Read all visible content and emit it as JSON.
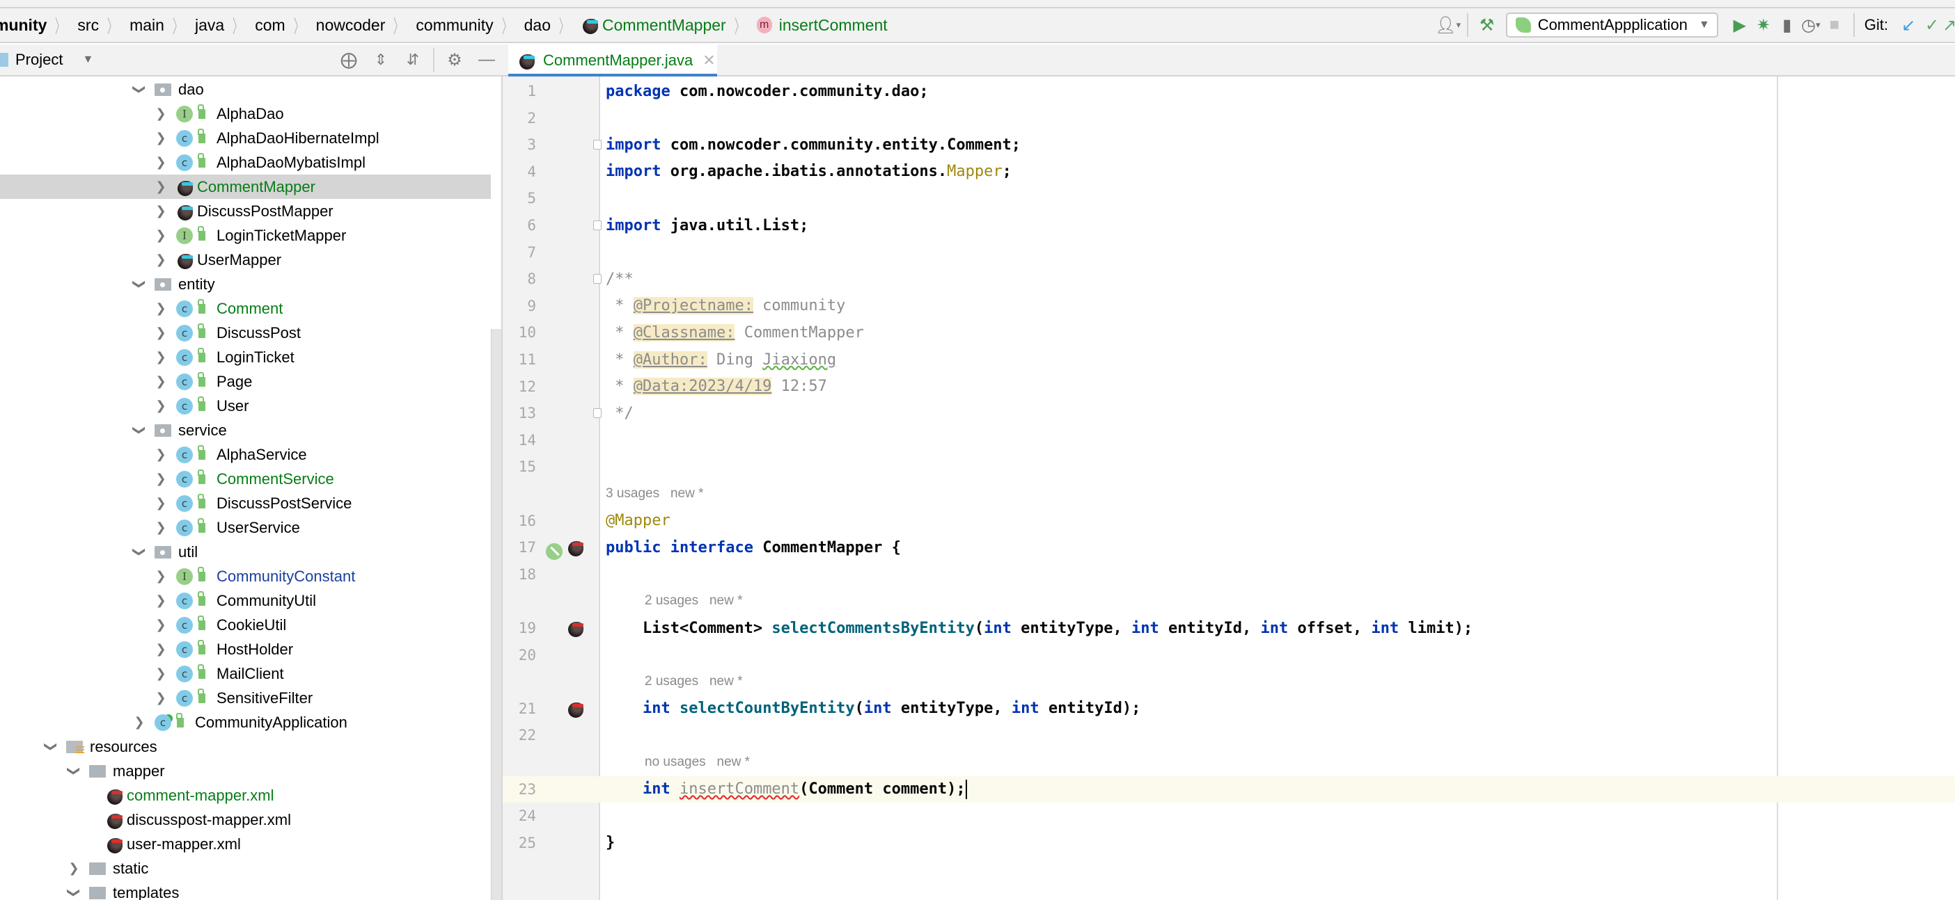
{
  "breadcrumb": {
    "items": [
      {
        "label": "munity",
        "style": "first"
      },
      {
        "label": "src"
      },
      {
        "label": "main"
      },
      {
        "label": "java"
      },
      {
        "label": "com"
      },
      {
        "label": "nowcoder"
      },
      {
        "label": "community"
      },
      {
        "label": "dao"
      },
      {
        "label": "CommentMapper",
        "icon": "mybatis-mapper-icon",
        "style": "green"
      },
      {
        "label": "insertComment",
        "icon": "method-icon",
        "style": "green"
      }
    ],
    "method_badge": "m"
  },
  "toolbar": {
    "run_config": "CommentAppplication",
    "git_label": "Git:"
  },
  "project_panel": {
    "title": "Project"
  },
  "tabs": [
    {
      "label": "CommentMapper.java",
      "active": true
    }
  ],
  "tree": [
    {
      "label": "dao",
      "type": "package",
      "level": 0,
      "expanded": true
    },
    {
      "label": "AlphaDao",
      "type": "interface",
      "level": 1,
      "color": "default"
    },
    {
      "label": "AlphaDaoHibernateImpl",
      "type": "class",
      "level": 1,
      "color": "default"
    },
    {
      "label": "AlphaDaoMybatisImpl",
      "type": "class",
      "level": 1,
      "color": "default"
    },
    {
      "label": "CommentMapper",
      "type": "mapper",
      "level": 1,
      "color": "green",
      "selected": true
    },
    {
      "label": "DiscussPostMapper",
      "type": "mapper",
      "level": 1,
      "color": "default"
    },
    {
      "label": "LoginTicketMapper",
      "type": "interface",
      "level": 1,
      "color": "default"
    },
    {
      "label": "UserMapper",
      "type": "mapper",
      "level": 1,
      "color": "default"
    },
    {
      "label": "entity",
      "type": "package",
      "level": 0,
      "expanded": true
    },
    {
      "label": "Comment",
      "type": "class",
      "level": 1,
      "color": "green"
    },
    {
      "label": "DiscussPost",
      "type": "class",
      "level": 1,
      "color": "default"
    },
    {
      "label": "LoginTicket",
      "type": "class",
      "level": 1,
      "color": "default"
    },
    {
      "label": "Page",
      "type": "class",
      "level": 1,
      "color": "default"
    },
    {
      "label": "User",
      "type": "class",
      "level": 1,
      "color": "default"
    },
    {
      "label": "service",
      "type": "package",
      "level": 0,
      "expanded": true
    },
    {
      "label": "AlphaService",
      "type": "class",
      "level": 1,
      "color": "default"
    },
    {
      "label": "CommentService",
      "type": "class",
      "level": 1,
      "color": "green"
    },
    {
      "label": "DiscussPostService",
      "type": "class",
      "level": 1,
      "color": "default"
    },
    {
      "label": "UserService",
      "type": "class",
      "level": 1,
      "color": "default"
    },
    {
      "label": "util",
      "type": "package",
      "level": 0,
      "expanded": true
    },
    {
      "label": "CommunityConstant",
      "type": "interface",
      "level": 1,
      "color": "blue"
    },
    {
      "label": "CommunityUtil",
      "type": "class",
      "level": 1,
      "color": "default"
    },
    {
      "label": "CookieUtil",
      "type": "class",
      "level": 1,
      "color": "default"
    },
    {
      "label": "HostHolder",
      "type": "class",
      "level": 1,
      "color": "default"
    },
    {
      "label": "MailClient",
      "type": "class",
      "level": 1,
      "color": "default"
    },
    {
      "label": "SensitiveFilter",
      "type": "class",
      "level": 1,
      "color": "default"
    },
    {
      "label": "CommunityApplication",
      "type": "spring-app",
      "level": 0,
      "color": "default"
    },
    {
      "label": "resources",
      "type": "resources-folder",
      "level": -2,
      "expanded": true
    },
    {
      "label": "mapper",
      "type": "folder",
      "level": -1,
      "expanded": true
    },
    {
      "label": "comment-mapper.xml",
      "type": "mapper-xml",
      "level": 0,
      "color": "green"
    },
    {
      "label": "discusspost-mapper.xml",
      "type": "mapper-xml",
      "level": 0,
      "color": "default"
    },
    {
      "label": "user-mapper.xml",
      "type": "mapper-xml",
      "level": 0,
      "color": "default"
    },
    {
      "label": "static",
      "type": "folder",
      "level": -1,
      "expanded": false
    },
    {
      "label": "templates",
      "type": "folder",
      "level": -1,
      "expanded": true
    }
  ],
  "editor": {
    "current_line": 23,
    "lines": [
      {
        "n": "1",
        "tokens": [
          [
            "kw",
            "package"
          ],
          [
            "t",
            " com.nowcoder.community.dao;"
          ]
        ]
      },
      {
        "n": "2",
        "tokens": []
      },
      {
        "n": "3",
        "fold": true,
        "tokens": [
          [
            "kw",
            "import"
          ],
          [
            "t",
            " com.nowcoder.community.entity.Comment;"
          ]
        ]
      },
      {
        "n": "4",
        "tokens": [
          [
            "kw",
            "import"
          ],
          [
            "t",
            " org.apache.ibatis.annotations."
          ],
          [
            "ann",
            "Mapper"
          ],
          [
            "t",
            ";"
          ]
        ]
      },
      {
        "n": "5",
        "tokens": []
      },
      {
        "n": "6",
        "fold": true,
        "tokens": [
          [
            "kw",
            "import"
          ],
          [
            "t",
            " java.util.List;"
          ]
        ]
      },
      {
        "n": "7",
        "tokens": []
      },
      {
        "n": "8",
        "fold": true,
        "tokens": [
          [
            "cmt",
            "/**"
          ]
        ]
      },
      {
        "n": "9",
        "tokens": [
          [
            "cmt",
            " * "
          ],
          [
            "tag",
            "@Projectname:"
          ],
          [
            "cmt",
            " community"
          ]
        ]
      },
      {
        "n": "10",
        "tokens": [
          [
            "cmt",
            " * "
          ],
          [
            "tag",
            "@Classname:"
          ],
          [
            "cmt",
            " CommentMapper"
          ]
        ]
      },
      {
        "n": "11",
        "tokens": [
          [
            "cmt",
            " * "
          ],
          [
            "tag",
            "@Author:"
          ],
          [
            "cmt",
            " Ding "
          ],
          [
            "typo",
            "Jiaxiong"
          ]
        ]
      },
      {
        "n": "12",
        "tokens": [
          [
            "cmt",
            " * "
          ],
          [
            "tag",
            "@Data:2023/4/19"
          ],
          [
            "cmt",
            " 12:57"
          ]
        ]
      },
      {
        "n": "13",
        "fold": true,
        "tokens": [
          [
            "cmt",
            " */"
          ]
        ]
      },
      {
        "n": "14",
        "tokens": []
      },
      {
        "n": "15",
        "tokens": []
      },
      {
        "hint": "3 usages   new *",
        "indent": 0
      },
      {
        "n": "16",
        "tokens": [
          [
            "ann",
            "@Mapper"
          ]
        ]
      },
      {
        "n": "17",
        "gutter": [
          "implemented-icon",
          "mybatis-icon"
        ],
        "tokens": [
          [
            "kw",
            "public"
          ],
          [
            "t",
            " "
          ],
          [
            "kw",
            "interface"
          ],
          [
            "t",
            " "
          ],
          [
            "b",
            "CommentMapper"
          ],
          [
            "t",
            " {"
          ]
        ]
      },
      {
        "n": "18",
        "tokens": []
      },
      {
        "hint": "2 usages   new *",
        "indent": 1
      },
      {
        "n": "19",
        "gutter": [
          "mybatis-icon"
        ],
        "tokens": [
          [
            "t",
            "    "
          ],
          [
            "b",
            "List<Comment>"
          ],
          [
            "t",
            " "
          ],
          [
            "fn",
            "selectCommentsByEntity"
          ],
          [
            "t",
            "("
          ],
          [
            "kw",
            "int"
          ],
          [
            "b",
            " entityType"
          ],
          [
            "t",
            ", "
          ],
          [
            "kw",
            "int"
          ],
          [
            "b",
            " entityId"
          ],
          [
            "t",
            ", "
          ],
          [
            "kw",
            "int"
          ],
          [
            "b",
            " offset"
          ],
          [
            "t",
            ", "
          ],
          [
            "kw",
            "int"
          ],
          [
            "b",
            " limit"
          ],
          [
            "t",
            ");"
          ]
        ]
      },
      {
        "n": "20",
        "tokens": []
      },
      {
        "hint": "2 usages   new *",
        "indent": 1
      },
      {
        "n": "21",
        "gutter": [
          "mybatis-icon"
        ],
        "tokens": [
          [
            "t",
            "    "
          ],
          [
            "kw",
            "int"
          ],
          [
            "t",
            " "
          ],
          [
            "fn",
            "selectCountByEntity"
          ],
          [
            "t",
            "("
          ],
          [
            "kw",
            "int"
          ],
          [
            "b",
            " entityType"
          ],
          [
            "t",
            ", "
          ],
          [
            "kw",
            "int"
          ],
          [
            "b",
            " entityId"
          ],
          [
            "t",
            ");"
          ]
        ]
      },
      {
        "n": "22",
        "tokens": []
      },
      {
        "hint": "no usages   new *",
        "indent": 1
      },
      {
        "n": "23",
        "current": true,
        "tokens": [
          [
            "t",
            "    "
          ],
          [
            "kw",
            "int"
          ],
          [
            "t",
            " "
          ],
          [
            "err",
            "insertComment"
          ],
          [
            "b",
            "(Comment comment);"
          ],
          [
            "caret",
            ""
          ]
        ]
      },
      {
        "n": "24",
        "tokens": []
      },
      {
        "n": "25",
        "tokens": [
          [
            "b",
            "}"
          ]
        ]
      }
    ]
  }
}
